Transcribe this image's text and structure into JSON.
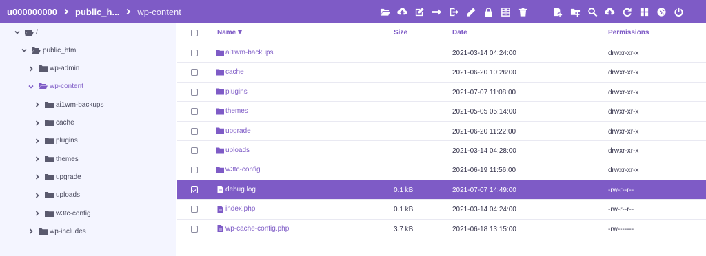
{
  "breadcrumb": {
    "items": [
      "u000000000",
      "public_h...",
      "wp-content"
    ]
  },
  "toolbar": {
    "icons": [
      "folder-open-icon",
      "cloud-upload-icon",
      "edit-box-icon",
      "arrow-right-icon",
      "move-out-icon",
      "pencil-icon",
      "lock-icon",
      "archive-icon",
      "trash-icon",
      "new-file-icon",
      "new-folder-icon",
      "search-icon",
      "upload-icon",
      "refresh-icon",
      "grid-icon",
      "globe-icon",
      "power-icon"
    ]
  },
  "colors": {
    "accent": "#7e5bc6",
    "sidebar_bg": "#f4f5ff",
    "text": "#36344d"
  },
  "tree": [
    {
      "label": "/",
      "level": 0,
      "expanded": true
    },
    {
      "label": "public_html",
      "level": 1,
      "expanded": true
    },
    {
      "label": "wp-admin",
      "level": 2,
      "expanded": false
    },
    {
      "label": "wp-content",
      "level": 2,
      "expanded": true,
      "active": true
    },
    {
      "label": "ai1wm-backups",
      "level": 3,
      "expanded": false
    },
    {
      "label": "cache",
      "level": 3,
      "expanded": false
    },
    {
      "label": "plugins",
      "level": 3,
      "expanded": false
    },
    {
      "label": "themes",
      "level": 3,
      "expanded": false
    },
    {
      "label": "upgrade",
      "level": 3,
      "expanded": false
    },
    {
      "label": "uploads",
      "level": 3,
      "expanded": false
    },
    {
      "label": "w3tc-config",
      "level": 3,
      "expanded": false
    },
    {
      "label": "wp-includes",
      "level": 2,
      "expanded": false
    }
  ],
  "table": {
    "columns": {
      "name": "Name",
      "size": "Size",
      "date": "Date",
      "permissions": "Permissions"
    },
    "rows": [
      {
        "type": "folder",
        "name": "ai1wm-backups",
        "size": "",
        "date": "2021-03-14 04:24:00",
        "perm": "drwxr-xr-x",
        "checked": false
      },
      {
        "type": "folder",
        "name": "cache",
        "size": "",
        "date": "2021-06-20 10:26:00",
        "perm": "drwxr-xr-x",
        "checked": false
      },
      {
        "type": "folder",
        "name": "plugins",
        "size": "",
        "date": "2021-07-07 11:08:00",
        "perm": "drwxr-xr-x",
        "checked": false
      },
      {
        "type": "folder",
        "name": "themes",
        "size": "",
        "date": "2021-05-05 05:14:00",
        "perm": "drwxr-xr-x",
        "checked": false
      },
      {
        "type": "folder",
        "name": "upgrade",
        "size": "",
        "date": "2021-06-20 11:22:00",
        "perm": "drwxr-xr-x",
        "checked": false
      },
      {
        "type": "folder",
        "name": "uploads",
        "size": "",
        "date": "2021-03-14 04:28:00",
        "perm": "drwxr-xr-x",
        "checked": false
      },
      {
        "type": "folder",
        "name": "w3tc-config",
        "size": "",
        "date": "2021-06-19 11:56:00",
        "perm": "drwxr-xr-x",
        "checked": false
      },
      {
        "type": "file",
        "name": "debug.log",
        "size": "0.1 kB",
        "date": "2021-07-07 14:49:00",
        "perm": "-rw-r--r--",
        "checked": true
      },
      {
        "type": "file",
        "name": "index.php",
        "size": "0.1 kB",
        "date": "2021-03-14 04:24:00",
        "perm": "-rw-r--r--",
        "checked": false
      },
      {
        "type": "file",
        "name": "wp-cache-config.php",
        "size": "3.7 kB",
        "date": "2021-06-18 13:15:00",
        "perm": "-rw-------",
        "checked": false
      }
    ]
  }
}
